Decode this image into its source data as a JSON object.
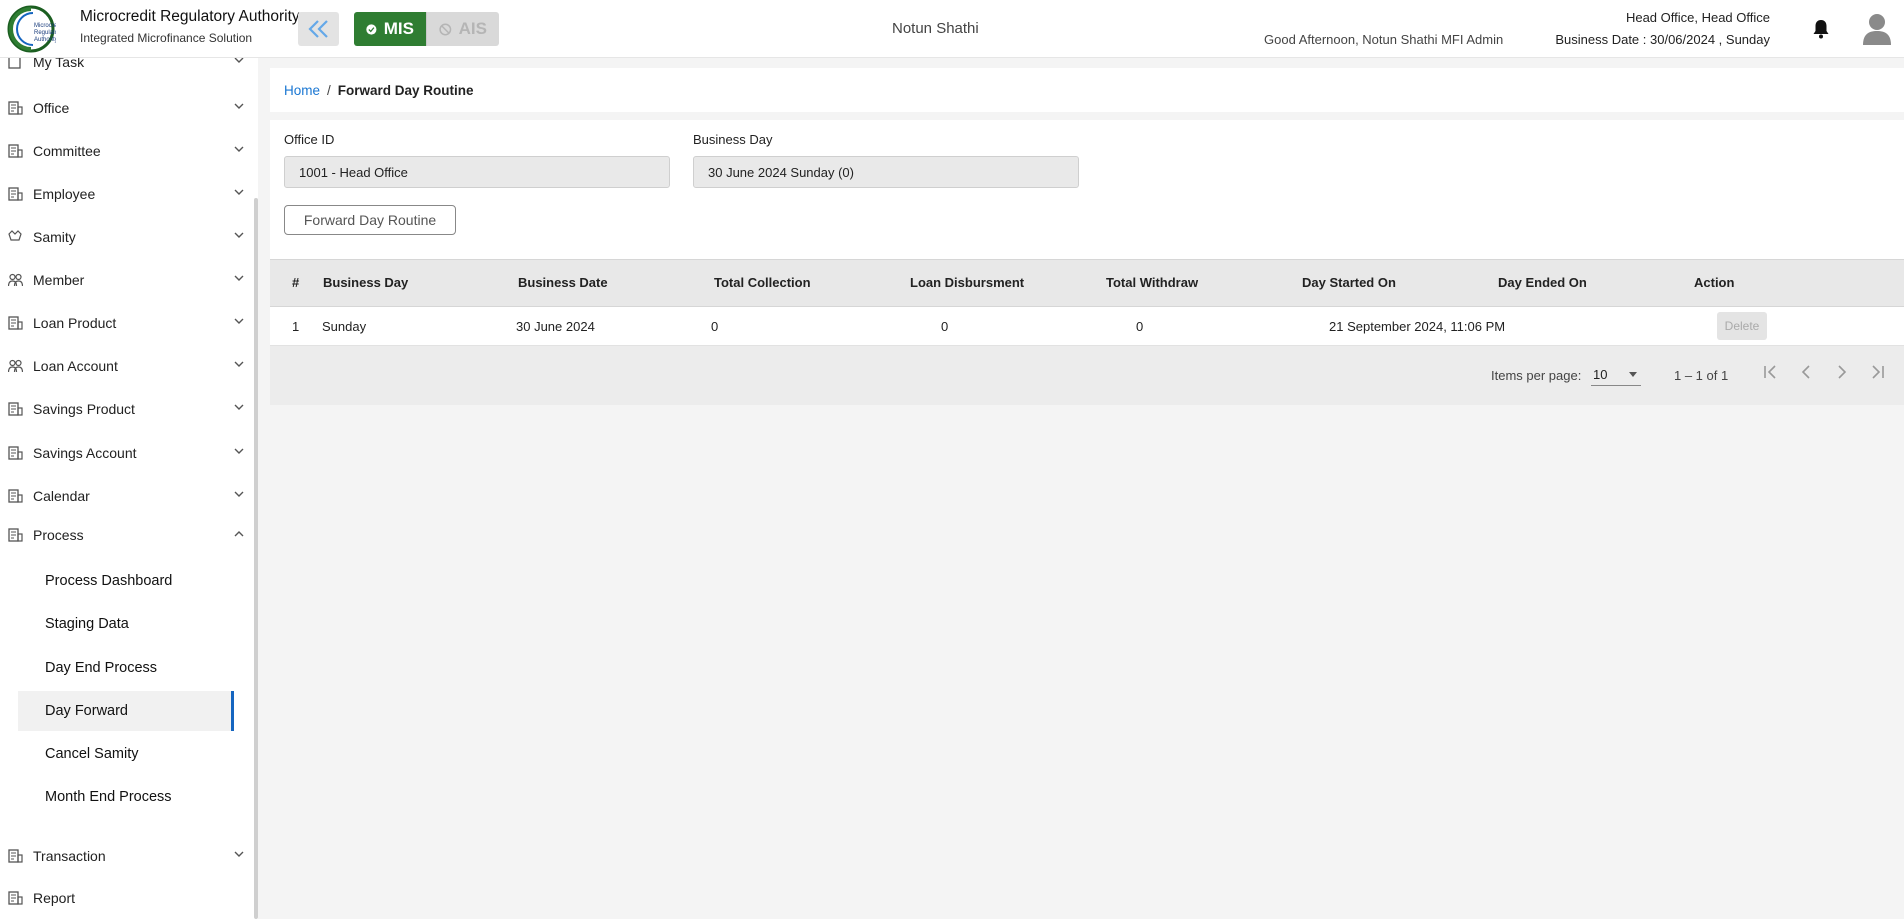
{
  "header": {
    "brand_title": "Microcredit Regulatory Authority",
    "brand_subtitle": "Integrated Microfinance Solution",
    "logo_text": "Microcredit Regulatory Authority",
    "mode_mis": "MIS",
    "mode_ais": "AIS",
    "app_name": "Notun Shathi",
    "greeting": "Good Afternoon, Notun Shathi MFI Admin",
    "office": "Head Office, Head Office",
    "business_date": "Business Date : 30/06/2024 , Sunday"
  },
  "sidebar": {
    "partial_top": "My Task",
    "items": [
      {
        "label": "Office",
        "icon": "office-icon"
      },
      {
        "label": "Committee",
        "icon": "committee-icon"
      },
      {
        "label": "Employee",
        "icon": "employee-icon"
      },
      {
        "label": "Samity",
        "icon": "samity-icon"
      },
      {
        "label": "Member",
        "icon": "member-icon"
      },
      {
        "label": "Loan Product",
        "icon": "loan-product-icon"
      },
      {
        "label": "Loan Account",
        "icon": "loan-account-icon"
      },
      {
        "label": "Savings Product",
        "icon": "savings-product-icon"
      },
      {
        "label": "Savings Account",
        "icon": "savings-account-icon"
      },
      {
        "label": "Calendar",
        "icon": "calendar-icon"
      },
      {
        "label": "Process",
        "icon": "process-icon"
      }
    ],
    "process_sub": [
      {
        "label": "Process Dashboard"
      },
      {
        "label": "Staging Data"
      },
      {
        "label": "Day End Process"
      },
      {
        "label": "Day Forward"
      },
      {
        "label": "Cancel Samity"
      },
      {
        "label": "Month End Process"
      }
    ],
    "bottom_items": [
      {
        "label": "Transaction"
      },
      {
        "label": "Report"
      }
    ]
  },
  "breadcrumb": {
    "home": "Home",
    "separator": "/",
    "current": "Forward Day Routine"
  },
  "form": {
    "office_label": "Office ID",
    "office_value": "1001 - Head Office",
    "business_day_label": "Business Day",
    "business_day_value": "30 June 2024 Sunday (0)",
    "button": "Forward Day Routine"
  },
  "table": {
    "headers": [
      "#",
      "Business Day",
      "Business Date",
      "Total Collection",
      "Loan Disbursment",
      "Total Withdraw",
      "Day Started On",
      "Day Ended On",
      "Action"
    ],
    "rows": [
      {
        "index": "1",
        "business_day": "Sunday",
        "business_date": "30 June 2024",
        "total_collection": "0",
        "loan_disbursment": "0",
        "total_withdraw": "0",
        "day_started_on": "21 September 2024, 11:06 PM",
        "day_ended_on": "",
        "action": "Delete"
      }
    ]
  },
  "paginator": {
    "items_per_page_label": "Items per page:",
    "items_per_page": "10",
    "range": "1 – 1 of 1"
  },
  "colors": {
    "accent": "#1565c0",
    "mis_green": "#2f7d32",
    "link": "#1976d2"
  }
}
